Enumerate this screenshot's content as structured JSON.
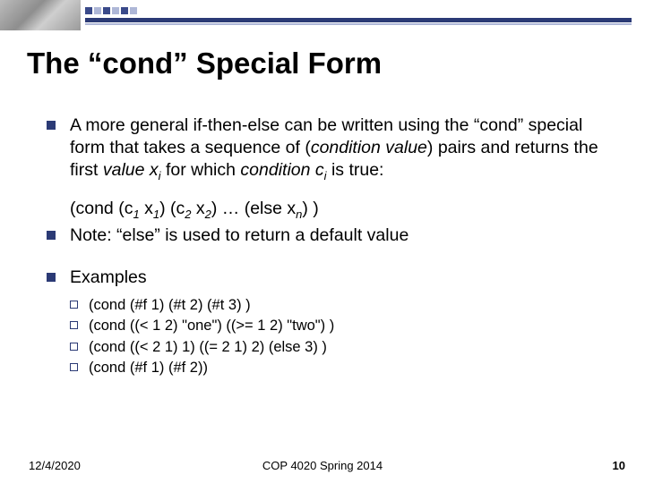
{
  "title": "The “cond” Special Form",
  "bullets": {
    "b1_pre": "A more general if-then-else can be written using the “cond” special form that takes a sequence of (",
    "b1_cv": "condition value",
    "b1_mid": ") pairs and returns the first ",
    "b1_val": "value x",
    "b1_sub1": "i",
    "b1_mid2": " for which ",
    "b1_cond": "condition c",
    "b1_sub2": "i",
    "b1_end": " is true:",
    "syntax_pre": "(cond (",
    "s_c1": "c",
    "s_1a": "1",
    "s_sp1": " ",
    "s_x1": "x",
    "s_1b": "1",
    "s_mid1": ") (",
    "s_c2": "c",
    "s_2a": "2",
    "s_sp2": " ",
    "s_x2": "x",
    "s_2b": "2",
    "s_mid2": ") … (else ",
    "s_xn": "x",
    "s_n": "n",
    "s_end": ") )",
    "b2": "Note: “else” is used to return a default value",
    "b3": "Examples",
    "ex1": "(cond (#f 1) (#t 2) (#t 3) )",
    "ex2": "(cond ((< 1 2) \"one\") ((>= 1 2) \"two\") )",
    "ex3": "(cond ((< 2 1) 1) ((= 2 1) 2) (else 3) )",
    "ex4": "(cond (#f 1) (#f 2))"
  },
  "footer": {
    "date": "12/4/2020",
    "course": "COP 4020 Spring 2014",
    "page": "10"
  }
}
